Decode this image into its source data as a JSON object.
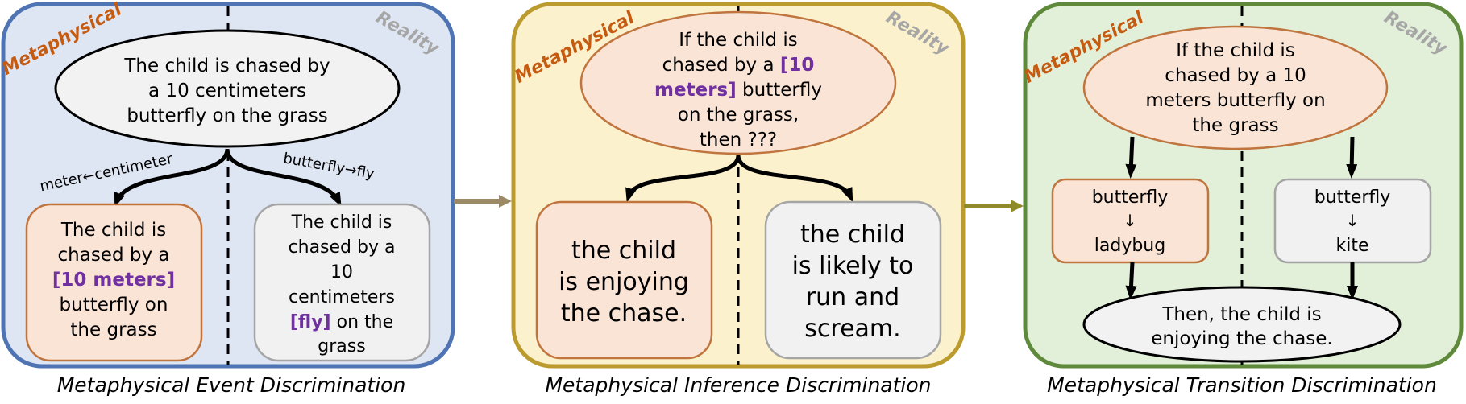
{
  "labels": {
    "metaphysical": "Metaphysical",
    "reality": "Reality"
  },
  "panel1": {
    "caption": "Metaphysical Event Discrimination",
    "top_lines": [
      "The child is chased by",
      "a 10 centimeters",
      "butterfly on the grass"
    ],
    "edge_left": "meter←centimeter",
    "edge_right": "butterfly→fly",
    "left_box": [
      {
        "text": "The child is",
        "highlight": false
      },
      {
        "text": "chased by a",
        "highlight": false
      },
      {
        "text": "[10 meters]",
        "highlight": true
      },
      {
        "text": "butterfly on",
        "highlight": false
      },
      {
        "text": "the grass",
        "highlight": false
      }
    ],
    "right_box": {
      "lines": [
        "The child is",
        "chased by a",
        "10",
        "centimeters"
      ],
      "hl": "[fly]",
      "hl_after": " on the",
      "last": "grass"
    }
  },
  "panel2": {
    "caption": "Metaphysical Inference Discrimination",
    "top_lines": [
      "If the child is",
      "then ???"
    ],
    "top_chased": "chased by a ",
    "top_hl1": "[10",
    "top_hl2": "meters]",
    "top_after": " butterfly",
    "top_grass": "on the grass,",
    "left_box": [
      "the child",
      "is enjoying",
      "the chase."
    ],
    "right_box": [
      "the child",
      "is likely to",
      "run and",
      "scream."
    ]
  },
  "panel3": {
    "caption": "Metaphysical Transition Discrimination",
    "top_lines": [
      "If the child is",
      "chased by a 10",
      "meters butterfly on",
      "the grass"
    ],
    "left_box": [
      "butterfly",
      "↓",
      "ladybug"
    ],
    "right_box": [
      "butterfly",
      "↓",
      "kite"
    ],
    "bottom_lines": [
      "Then, the child is",
      "enjoying the chase."
    ]
  },
  "colors": {
    "panel1_fill": "#dfe6f3",
    "panel1_border": "#4f74b4",
    "panel2_fill": "#fbf1cc",
    "panel2_border": "#bb9a2e",
    "panel3_fill": "#e2efd9",
    "panel3_border": "#5f8a3c",
    "meta_fill": "#fae4d6",
    "meta_border": "#c0743e",
    "real_fill": "#f1f1f1",
    "real_border": "#a5a5a5",
    "highlight": "#7030a0",
    "meta_label": "#c55a11",
    "reality_label": "#a6a6a6"
  }
}
